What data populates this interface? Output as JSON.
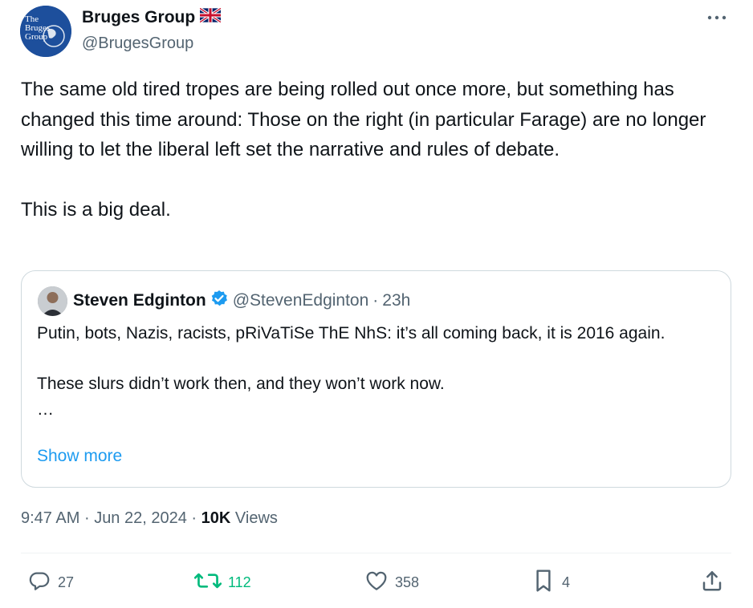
{
  "author": {
    "avatar_text": "The Bruges Group",
    "name": "Bruges Group",
    "flag": "🇬🇧",
    "handle": "@BrugesGroup"
  },
  "tweet": {
    "text": "The same old tired tropes are being rolled out once more, but something has changed this time around: Those on the right (in particular Farage) are no longer willing to let the liberal left set the narrative and rules of debate.\n\nThis is a big deal."
  },
  "quote": {
    "name": "Steven Edginton",
    "handle": "@StevenEdginton",
    "separator": "·",
    "time": "23h",
    "text": "Putin, bots, Nazis, racists, pRiVaTiSe ThE NhS: it’s all coming back, it is 2016 again.\n\nThese slurs didn’t work then, and they won’t work now.\n…",
    "show_more": "Show more"
  },
  "meta": {
    "time": "9:47 AM",
    "sep1": "·",
    "date": "Jun 22, 2024",
    "sep2": "·",
    "views_count": "10K",
    "views_label": "Views"
  },
  "actions": {
    "replies": "27",
    "reposts": "112",
    "likes": "358",
    "bookmarks": "4"
  },
  "colors": {
    "text": "#0f1419",
    "secondary": "#536471",
    "link": "#1d9bf0",
    "repost_active": "#00ba7c",
    "border": "#cfd9de",
    "verified": "#1d9bf0"
  },
  "icons": [
    "more-icon",
    "verified-icon",
    "reply-icon",
    "repost-icon",
    "like-icon",
    "bookmark-icon",
    "share-icon"
  ]
}
